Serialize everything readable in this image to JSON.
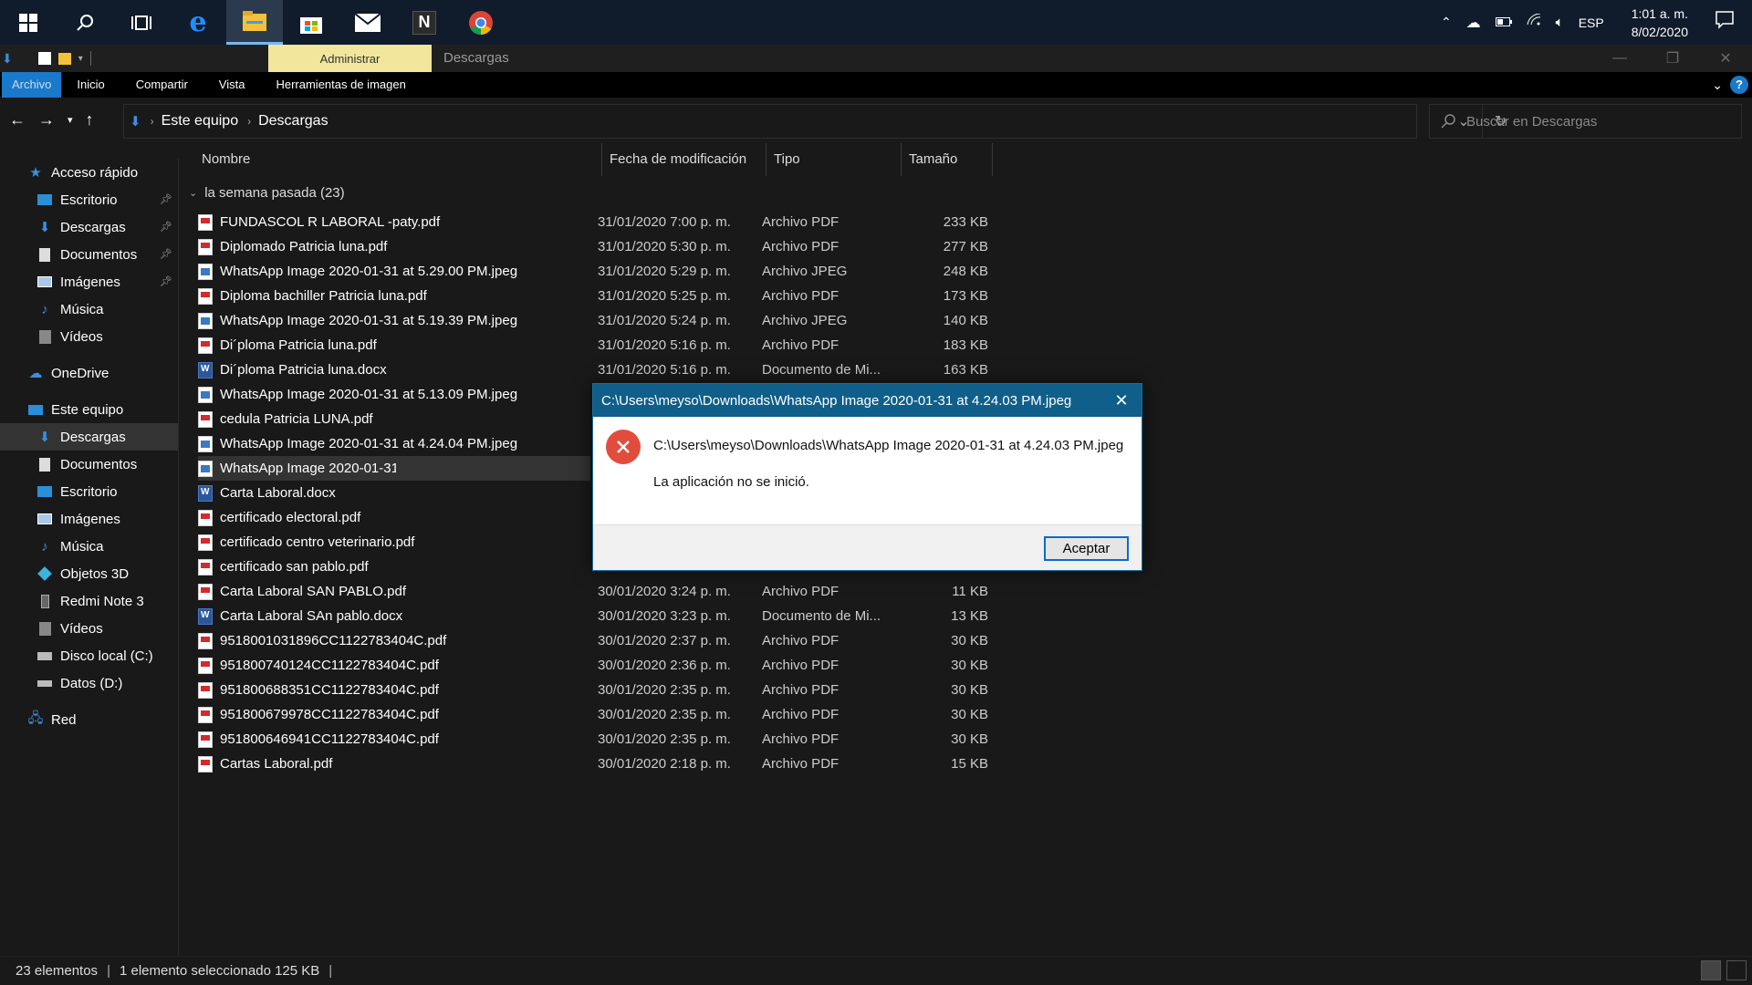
{
  "taskbar": {
    "apps": [
      "start-icon",
      "search-icon",
      "task-view-icon",
      "edge-icon",
      "file-explorer-icon",
      "store-icon",
      "mail-icon",
      "notion-icon",
      "chrome-icon"
    ],
    "lang": "ESP",
    "time": "1:01 a. m.",
    "date": "8/02/2020"
  },
  "window": {
    "context_tab": "Administrar",
    "title": "Descargas"
  },
  "ribbon": {
    "tabs": [
      "Archivo",
      "Inicio",
      "Compartir",
      "Vista",
      "Herramientas de imagen"
    ]
  },
  "address": {
    "crumbs": [
      "Este equipo",
      "Descargas"
    ],
    "search_placeholder": "Buscar en Descargas"
  },
  "sidebar": {
    "quick_access": "Acceso rápido",
    "quick": [
      "Escritorio",
      "Descargas",
      "Documentos",
      "Imágenes",
      "Música",
      "Vídeos"
    ],
    "onedrive": "OneDrive",
    "this_pc": "Este equipo",
    "pc": [
      "Descargas",
      "Documentos",
      "Escritorio",
      "Imágenes",
      "Música",
      "Objetos 3D",
      "Redmi Note 3",
      "Vídeos",
      "Disco local (C:)",
      "Datos (D:)"
    ],
    "network": "Red"
  },
  "columns": [
    "Nombre",
    "Fecha de modificación",
    "Tipo",
    "Tamaño"
  ],
  "group_label": "la semana pasada (23)",
  "files": [
    {
      "name": "FUNDASCOL R LABORAL -paty.pdf",
      "date": "31/01/2020 7:00 p. m.",
      "type": "Archivo PDF",
      "size": "233 KB",
      "kind": "pdf"
    },
    {
      "name": "Diplomado Patricia luna.pdf",
      "date": "31/01/2020 5:30 p. m.",
      "type": "Archivo PDF",
      "size": "277 KB",
      "kind": "pdf"
    },
    {
      "name": "WhatsApp Image 2020-01-31 at 5.29.00 PM.jpeg",
      "date": "31/01/2020 5:29 p. m.",
      "type": "Archivo JPEG",
      "size": "248 KB",
      "kind": "jpeg"
    },
    {
      "name": "Diploma  bachiller Patricia luna.pdf",
      "date": "31/01/2020 5:25 p. m.",
      "type": "Archivo PDF",
      "size": "173 KB",
      "kind": "pdf"
    },
    {
      "name": "WhatsApp Image 2020-01-31 at 5.19.39 PM.jpeg",
      "date": "31/01/2020 5:24 p. m.",
      "type": "Archivo JPEG",
      "size": "140 KB",
      "kind": "jpeg"
    },
    {
      "name": "Di´ploma Patricia luna.pdf",
      "date": "31/01/2020 5:16 p. m.",
      "type": "Archivo PDF",
      "size": "183 KB",
      "kind": "pdf"
    },
    {
      "name": "Di´ploma Patricia luna.docx",
      "date": "31/01/2020 5:16 p. m.",
      "type": "Documento de Mi...",
      "size": "163 KB",
      "kind": "docx"
    },
    {
      "name": "WhatsApp Image 2020-01-31 at 5.13.09 PM.jpeg",
      "date": "",
      "type": "",
      "size": "",
      "kind": "jpeg"
    },
    {
      "name": "cedula Patricia LUNA.pdf",
      "date": "",
      "type": "",
      "size": "",
      "kind": "pdf"
    },
    {
      "name": "WhatsApp Image 2020-01-31 at 4.24.04 PM.jpeg",
      "date": "",
      "type": "",
      "size": "",
      "kind": "jpeg"
    },
    {
      "name": "WhatsApp Image 2020-01-31 at 4.24.03 PM.jpeg",
      "date": "",
      "type": "",
      "size": "",
      "kind": "jpeg",
      "selected": true
    },
    {
      "name": "Carta Laboral.docx",
      "date": "",
      "type": "",
      "size": "",
      "kind": "docx"
    },
    {
      "name": "certificado electoral.pdf",
      "date": "",
      "type": "",
      "size": "",
      "kind": "pdf"
    },
    {
      "name": "certificado centro veterinario.pdf",
      "date": "",
      "type": "",
      "size": "",
      "kind": "pdf"
    },
    {
      "name": "certificado san pablo.pdf",
      "date": "",
      "type": "",
      "size": "",
      "kind": "pdf"
    },
    {
      "name": "Carta Laboral SAN PABLO.pdf",
      "date": "30/01/2020 3:24 p. m.",
      "type": "Archivo PDF",
      "size": "11 KB",
      "kind": "pdf"
    },
    {
      "name": "Carta Laboral SAn pablo.docx",
      "date": "30/01/2020 3:23 p. m.",
      "type": "Documento de Mi...",
      "size": "13 KB",
      "kind": "docx"
    },
    {
      "name": "9518001031896CC1122783404C.pdf",
      "date": "30/01/2020 2:37 p. m.",
      "type": "Archivo PDF",
      "size": "30 KB",
      "kind": "pdf"
    },
    {
      "name": "951800740124CC1122783404C.pdf",
      "date": "30/01/2020 2:36 p. m.",
      "type": "Archivo PDF",
      "size": "30 KB",
      "kind": "pdf"
    },
    {
      "name": "951800688351CC1122783404C.pdf",
      "date": "30/01/2020 2:35 p. m.",
      "type": "Archivo PDF",
      "size": "30 KB",
      "kind": "pdf"
    },
    {
      "name": "951800679978CC1122783404C.pdf",
      "date": "30/01/2020 2:35 p. m.",
      "type": "Archivo PDF",
      "size": "30 KB",
      "kind": "pdf"
    },
    {
      "name": "951800646941CC1122783404C.pdf",
      "date": "30/01/2020 2:35 p. m.",
      "type": "Archivo PDF",
      "size": "30 KB",
      "kind": "pdf"
    },
    {
      "name": "Cartas Laboral.pdf",
      "date": "30/01/2020 2:18 p. m.",
      "type": "Archivo PDF",
      "size": "15 KB",
      "kind": "pdf"
    }
  ],
  "status": {
    "count": "23 elementos",
    "selection": "1 elemento seleccionado  125 KB"
  },
  "dialog": {
    "title": "C:\\Users\\meyso\\Downloads\\WhatsApp Image 2020-01-31 at 4.24.03 PM.jpeg",
    "path": "C:\\Users\\meyso\\Downloads\\WhatsApp Image 2020-01-31 at 4.24.03 PM.jpeg",
    "message": "La aplicación no se inició.",
    "ok_label": "Aceptar"
  },
  "colors": {
    "accent": "#1979ca",
    "dialog_title_bg": "#0f5f8a",
    "error_red": "#e24c3c",
    "context_tab": "#f1e69c"
  }
}
